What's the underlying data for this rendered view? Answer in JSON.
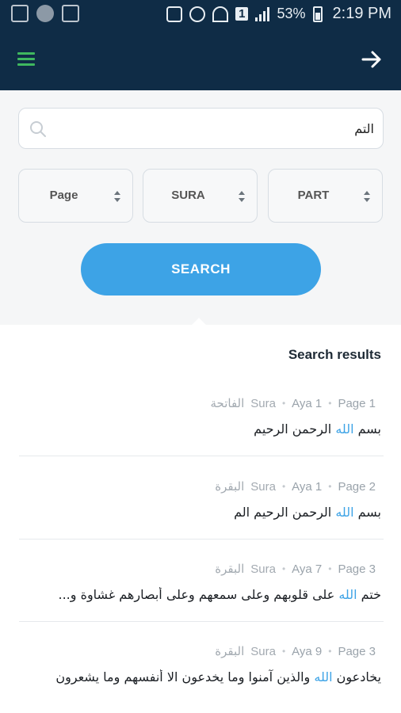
{
  "status_bar": {
    "battery": "53%",
    "time": "2:19 PM",
    "sim": "1"
  },
  "search": {
    "query": "التم",
    "selects": [
      "Page",
      "SURA",
      "PART"
    ],
    "button_label": "SEARCH"
  },
  "results": {
    "title": "Search results",
    "items": [
      {
        "page": "Page 1",
        "aya": "Aya 1",
        "sura_label": "Sura",
        "sura_name": "الفاتحة",
        "before": "بسم ",
        "highlight": "الله",
        "after": " الرحمن الرحيم"
      },
      {
        "page": "Page 2",
        "aya": "Aya 1",
        "sura_label": "Sura",
        "sura_name": "البقرة",
        "before": "بسم ",
        "highlight": "الله",
        "after": " الرحمن الرحيم الم"
      },
      {
        "page": "Page 3",
        "aya": "Aya 7",
        "sura_label": "Sura",
        "sura_name": "البقرة",
        "before": "ختم ",
        "highlight": "الله",
        "after": " على قلوبهم وعلى سمعهم وعلى أبصارهم غشاوة و..."
      },
      {
        "page": "Page 3",
        "aya": "Aya 9",
        "sura_label": "Sura",
        "sura_name": "البقرة",
        "before": "يخادعون ",
        "highlight": "الله",
        "after": " والذين آمنوا وما يخدعون الا أنفسهم وما يشعرون"
      }
    ]
  },
  "colors": {
    "header": "#0f2c46",
    "accent": "#3da3e6",
    "menu": "#3fb85f"
  }
}
